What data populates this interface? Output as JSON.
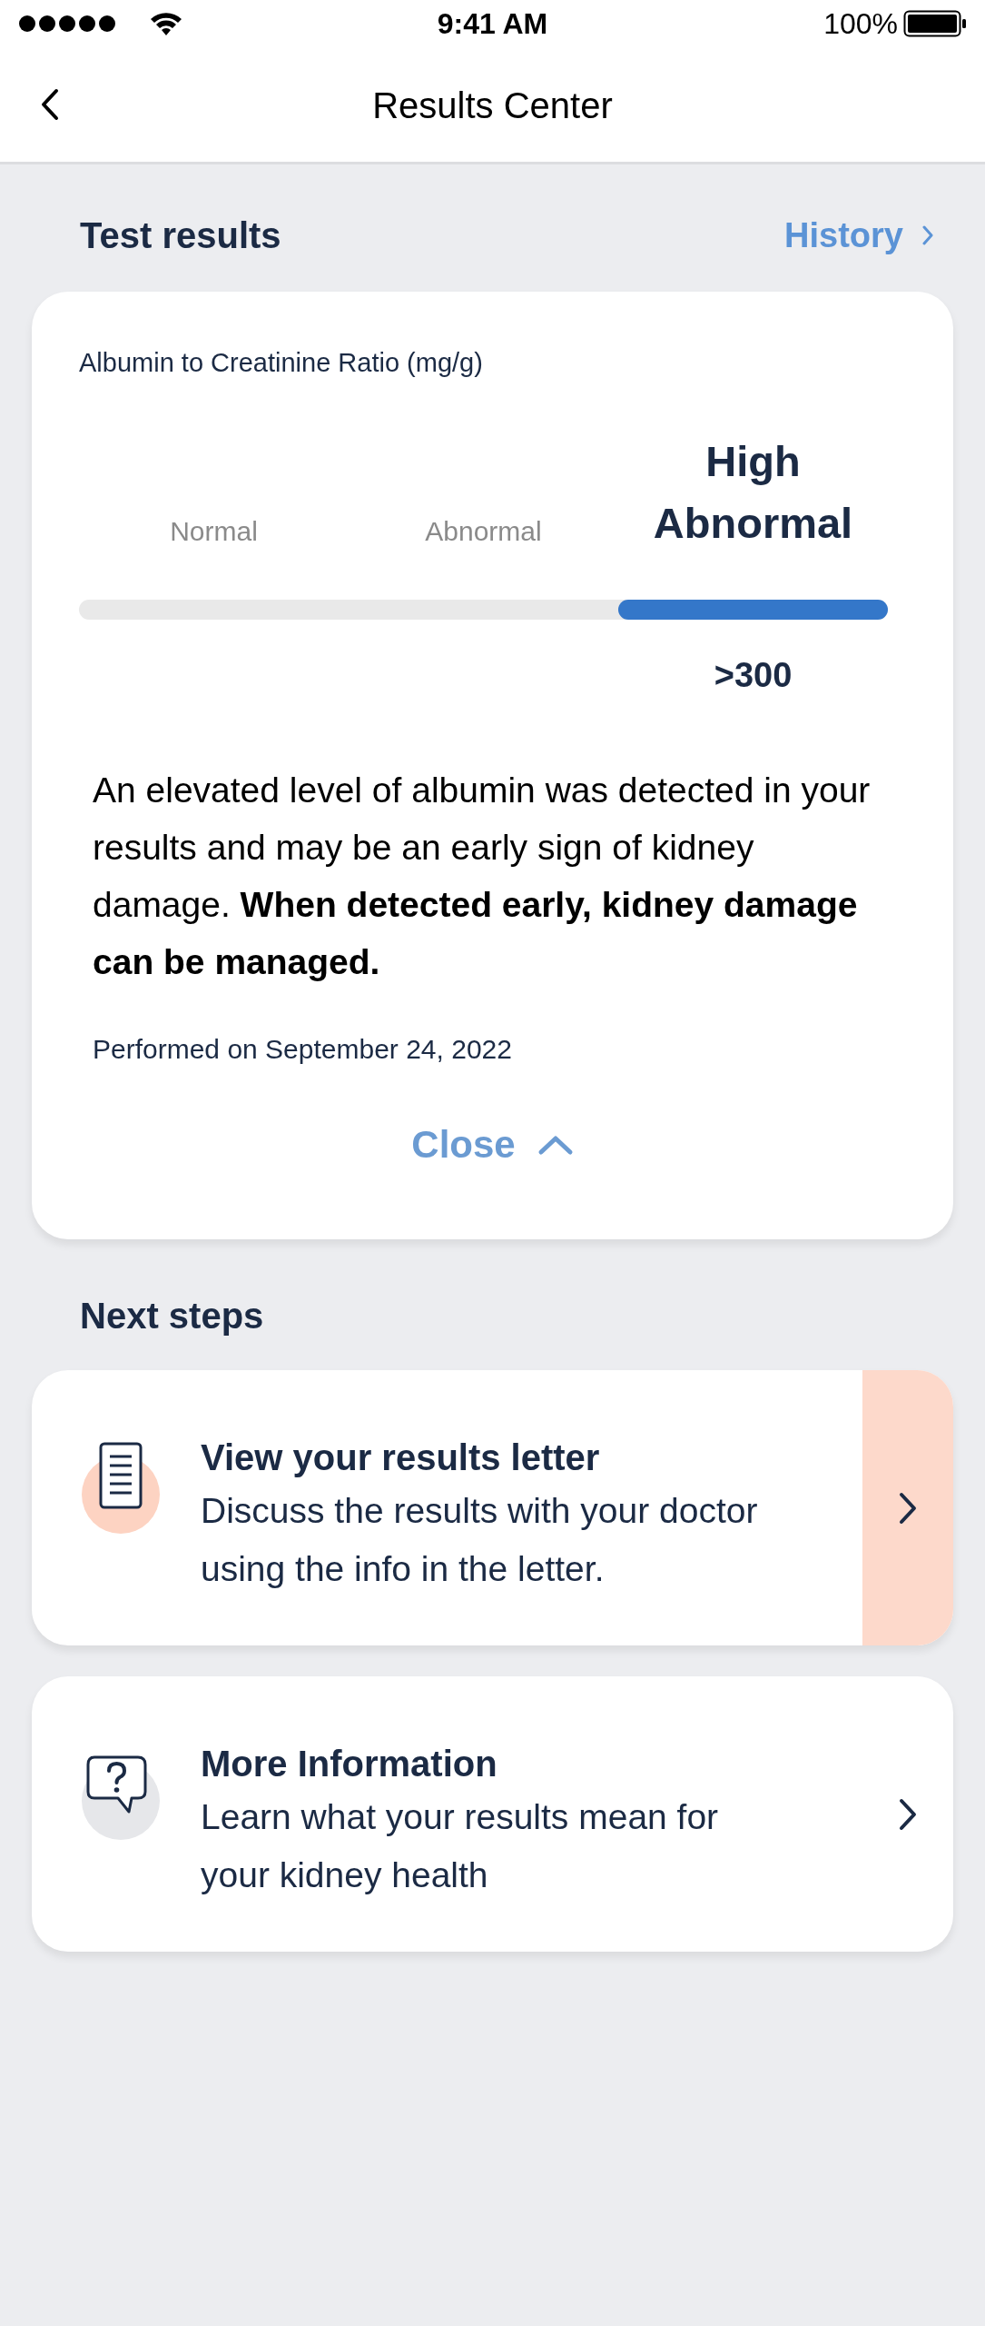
{
  "status_bar": {
    "time": "9:41 AM",
    "battery": "100%"
  },
  "nav": {
    "title": "Results Center"
  },
  "test_results": {
    "heading": "Test results",
    "history_link": "History",
    "card": {
      "measure": "Albumin to Creatinine Ratio (mg/g)",
      "ranges": [
        {
          "label": "Normal",
          "selected": false
        },
        {
          "label": "Abnormal",
          "selected": false
        },
        {
          "label": "High Abnormal",
          "selected": true
        }
      ],
      "value": ">300",
      "description": "An elevated level of albumin was detected in your results and may be an early sign of kidney damage. **When detected early, kidney damage can be managed.**",
      "performed": "Performed on September 24, 2022",
      "close": "Close"
    }
  },
  "next_steps": {
    "heading": "Next steps",
    "items": [
      {
        "kind": "letter",
        "highlighted": true,
        "title": "View your results letter",
        "description": "Discuss the results with your doctor using the info in the letter."
      },
      {
        "kind": "info",
        "highlighted": false,
        "title": "More Information",
        "description": "Learn what your results mean for your kidney health"
      }
    ]
  }
}
